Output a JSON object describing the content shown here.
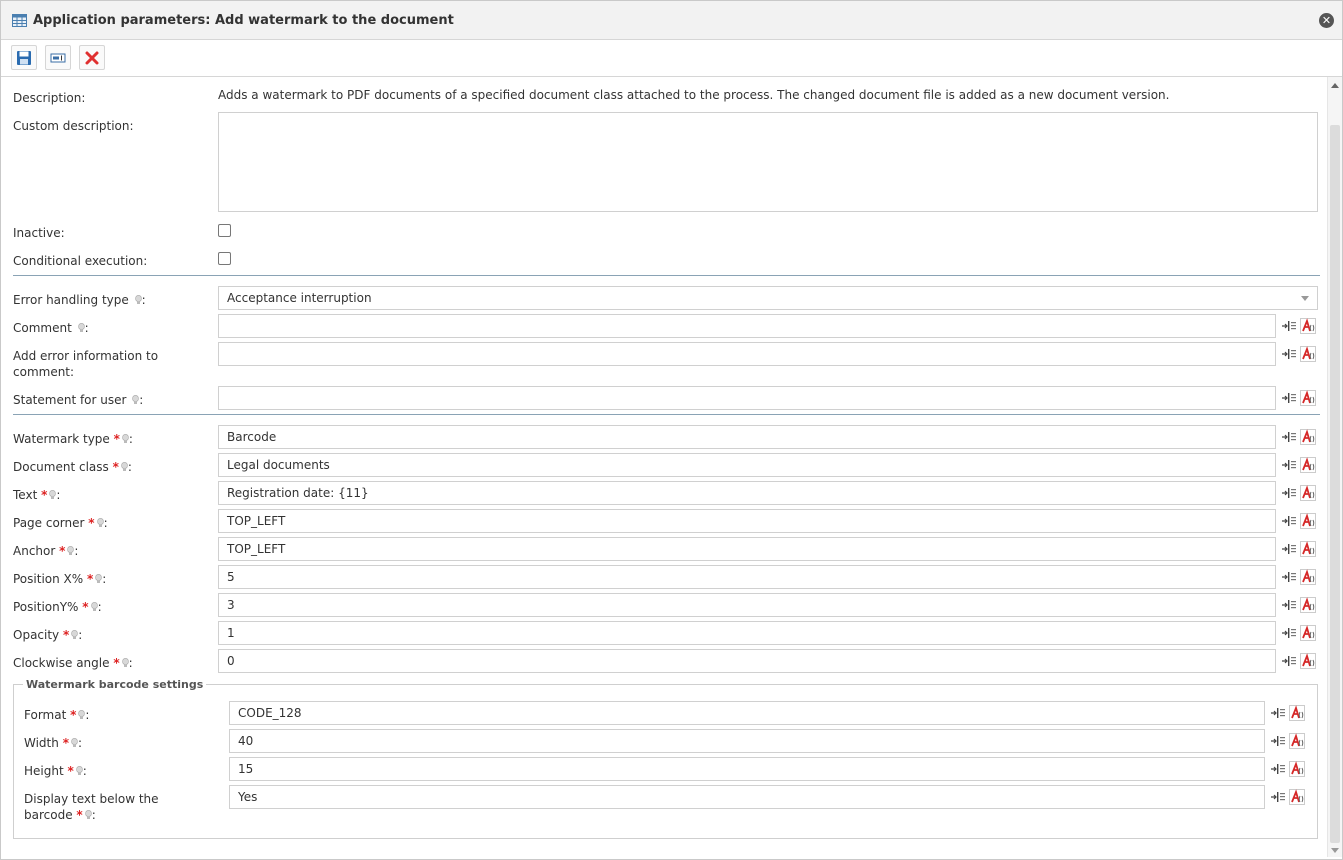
{
  "window": {
    "title": "Application parameters: Add watermark to the document",
    "close_glyph": "✕"
  },
  "toolbar": {
    "save_icon": "save-icon",
    "parameters_icon": "parameters-icon",
    "delete_icon": "delete-icon"
  },
  "form": {
    "description_label": "Description:",
    "description_text": "Adds a watermark to PDF documents of a specified document class attached to the process. The changed document file is added as a new document version.",
    "custom_description_label": "Custom description:",
    "inactive_label": "Inactive:",
    "conditional_label": "Conditional execution:",
    "error_handling_label": "Error handling type",
    "error_handling_value": "Acceptance interruption",
    "comment_label": "Comment",
    "add_error_label_line1": "Add error information to",
    "add_error_label_line2": "comment:",
    "statement_label": "Statement for user",
    "fields": [
      {
        "label": "Watermark type",
        "value": "Barcode"
      },
      {
        "label": "Document class",
        "value": "Legal documents"
      },
      {
        "label": "Text",
        "value": "Registration date: {11}"
      },
      {
        "label": "Page corner",
        "value": "TOP_LEFT"
      },
      {
        "label": "Anchor",
        "value": "TOP_LEFT"
      },
      {
        "label": "Position X%",
        "value": "5"
      },
      {
        "label": "PositionY%",
        "value": "3"
      },
      {
        "label": "Opacity",
        "value": "1"
      },
      {
        "label": "Clockwise angle",
        "value": "0"
      }
    ],
    "barcode_group_title": "Watermark barcode settings",
    "barcode_fields": [
      {
        "label": "Format",
        "value": "CODE_128"
      },
      {
        "label": "Width",
        "value": "40"
      },
      {
        "label": "Height",
        "value": "15"
      }
    ],
    "display_text_label_line1": "Display text below the",
    "display_text_label_line2": "barcode",
    "display_text_value": "Yes",
    "required_mark": "*",
    "colon": ":"
  },
  "colors": {
    "separator": "#8aa3b5",
    "required": "#dd2222",
    "delete": "#e03030"
  }
}
